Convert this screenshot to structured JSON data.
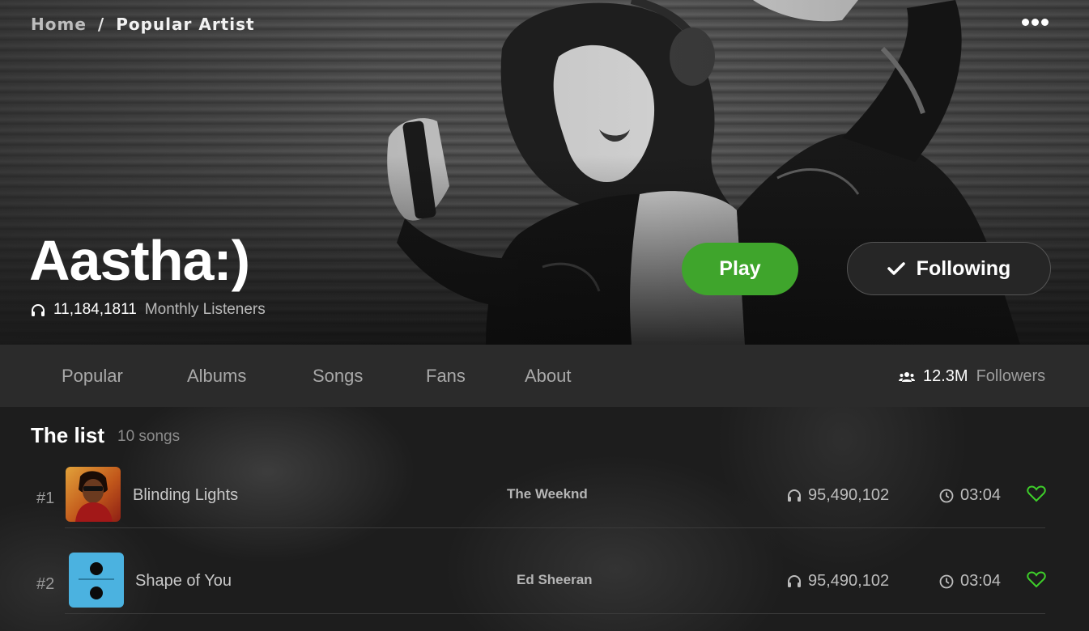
{
  "breadcrumb": {
    "home": "Home",
    "separator": "/",
    "current": "Popular Artist"
  },
  "header": {
    "more_icon": "more-horizontal-icon"
  },
  "artist": {
    "name": "Aastha:)",
    "listeners_count": "11,184,1811",
    "listeners_label": "Monthly Listeners",
    "listeners_icon": "headphones-icon"
  },
  "actions": {
    "play_label": "Play",
    "follow_label": "Following",
    "follow_icon": "check-icon"
  },
  "tabs": [
    {
      "label": "Popular"
    },
    {
      "label": "Albums"
    },
    {
      "label": "Songs"
    },
    {
      "label": "Fans"
    },
    {
      "label": "About"
    }
  ],
  "followers": {
    "count": "12.3M",
    "label": "Followers",
    "icon": "users-icon"
  },
  "list": {
    "title": "The list",
    "count_label": "10 songs",
    "songs": [
      {
        "rank": "#1",
        "title": "Blinding Lights",
        "artist": "The Weeknd",
        "plays": "95,490,102",
        "duration": "03:04",
        "liked": true
      },
      {
        "rank": "#2",
        "title": "Shape of You",
        "artist": "Ed Sheeran",
        "plays": "95,490,102",
        "duration": "03:04",
        "liked": true
      }
    ]
  },
  "colors": {
    "accent": "#3fa52c",
    "like": "#3ecf2a",
    "tabbar": "#2b2b2b"
  }
}
